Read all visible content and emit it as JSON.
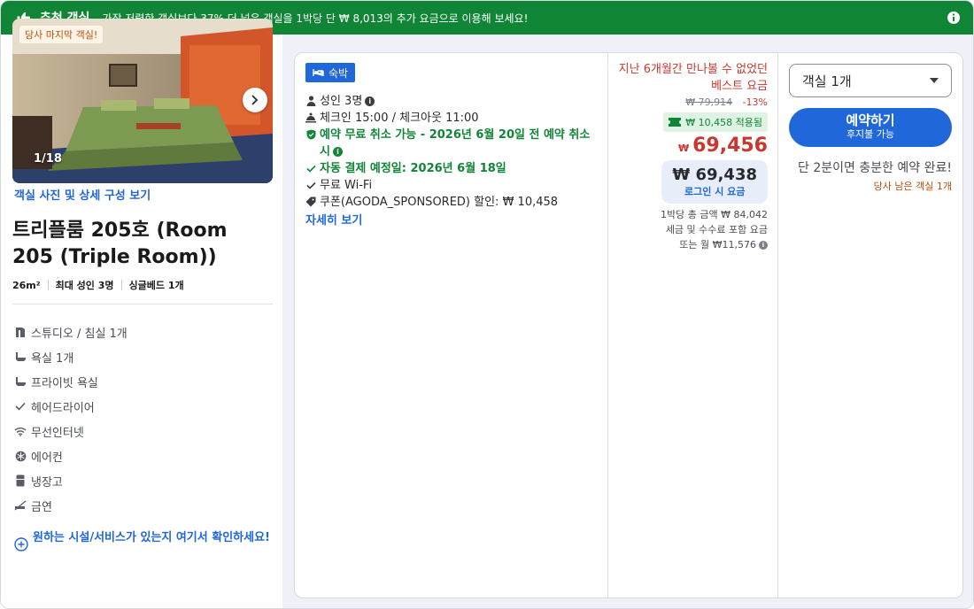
{
  "banner": {
    "title": "추천 객실",
    "message": "가장 저렴한 객실보다 37% 더 넓은 객실을 1박당 단 ₩ 8,013의 추가 요금으로 이용해 보세요!"
  },
  "room": {
    "badge": "당사 마지막 객실!",
    "photo_counter": "1/18",
    "photos_link": "객실 사진 및 상세 구성 보기",
    "name": "트리플룸 205호 (Room 205 (Triple Room))",
    "specs": [
      "26m²",
      "최대 성인 3명",
      "싱글베드 1개"
    ],
    "amenities": [
      {
        "icon": "studio-icon",
        "label": "스튜디오 / 침실 1개"
      },
      {
        "icon": "bath-icon",
        "label": "욕실 1개"
      },
      {
        "icon": "bath-icon",
        "label": "프라이빗 욕실"
      },
      {
        "icon": "check-icon",
        "label": "헤어드라이어"
      },
      {
        "icon": "wifi-icon",
        "label": "무선인터넷"
      },
      {
        "icon": "snowflake-icon",
        "label": "에어컨"
      },
      {
        "icon": "fridge-icon",
        "label": "냉장고"
      },
      {
        "icon": "no-smoking-icon",
        "label": "금연"
      }
    ],
    "facility_link": "원하는 시설/서비스가 있는지 여기서 확인하세요!"
  },
  "offer": {
    "badge": "숙박",
    "guests": "성인 3명",
    "checkin": "체크인 15:00 / 체크아웃 11:00",
    "free_cancel": "예약 무료 취소 가능 - 2026년 6월 20일 전 예약 취소 시",
    "auto_pay": "자동 결제 예정일: 2026년 6월 18일",
    "wifi": "무료 Wi-Fi",
    "coupon": "쿠폰(AGODA_SPONSORED) 할인: ₩ 10,458",
    "details_link": "자세히 보기"
  },
  "price": {
    "best_label": "지난 6개월간 만나볼 수 없었던 베스트 요금",
    "original": "₩ 79,914",
    "discount": "-13%",
    "coupon_applied": "₩ 10,458 적용됨",
    "currency": "₩",
    "amount": "69,456",
    "login_price": "₩ 69,438",
    "login_label": "로그인 시 요금",
    "total": "1박당 총 금액 ₩ 84,042",
    "tax_note": "세금 및 수수료 포함 요금",
    "monthly": "또는 월 ₩11,576"
  },
  "booking": {
    "room_select": "객실 1개",
    "book_label": "예약하기",
    "pay_later": "후지불 가능",
    "urgency": "단 2분이면 충분한 예약 완료!",
    "rooms_left": "당사 남은 객실 1개"
  },
  "colors": {
    "banner_green": "#118536",
    "brand_blue": "#2067da",
    "price_red": "#c8382f",
    "gray_bg": "#eef1f7"
  }
}
